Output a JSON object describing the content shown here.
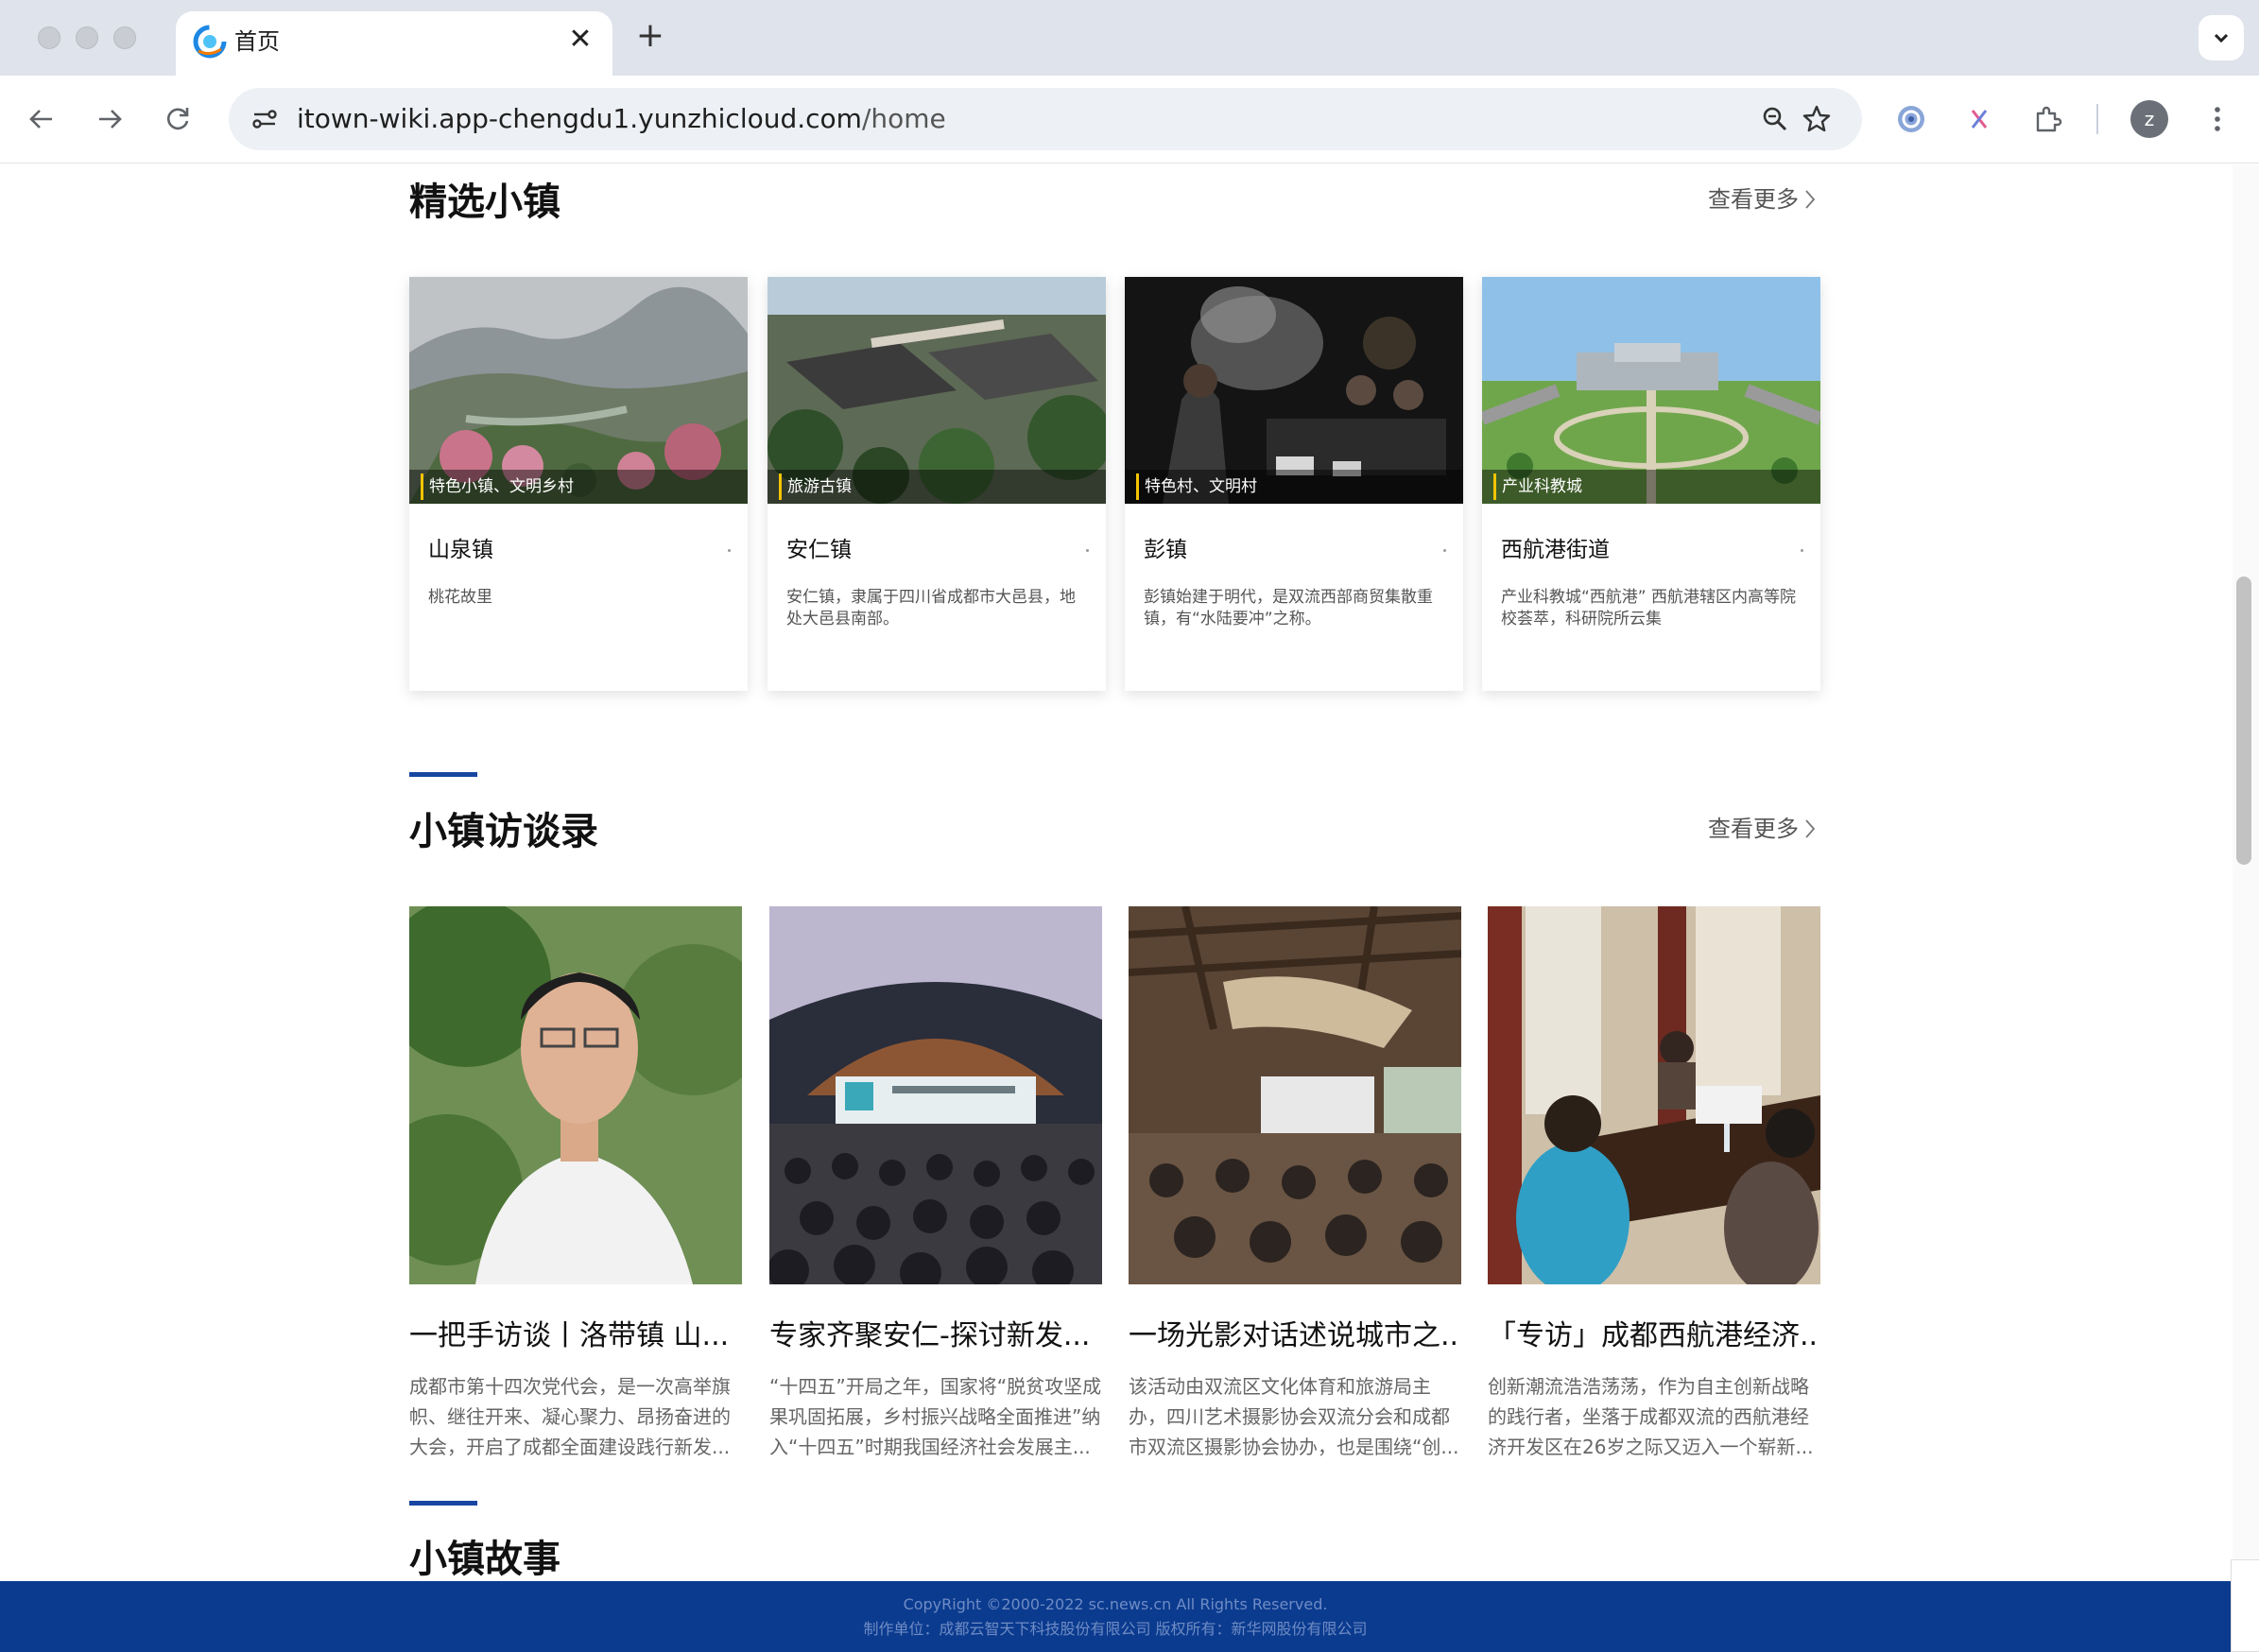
{
  "browser": {
    "tab_title": "首页",
    "url_host": "itown-wiki.app-chengdu1.yunzhicloud.com",
    "url_path": "/home",
    "profile_initial": "z",
    "icons": [
      "back-icon",
      "forward-icon",
      "reload-icon",
      "site-info-icon",
      "zoom-icon",
      "bookmark-star-icon",
      "extension-icon",
      "puzzle-icon",
      "menu-icon"
    ]
  },
  "featured": {
    "title": "精选小镇",
    "more": "查看更多",
    "cards": [
      {
        "tag": "特色小镇、文明乡村",
        "name": "山泉镇",
        "desc": "桃花故里"
      },
      {
        "tag": "旅游古镇",
        "name": "安仁镇",
        "desc": "安仁镇，隶属于四川省成都市大邑县，地处大邑县南部。"
      },
      {
        "tag": "特色村、文明村",
        "name": "彭镇",
        "desc": "彭镇始建于明代，是双流西部商贸集散重镇，有“水陆要冲”之称。"
      },
      {
        "tag": "产业科教城",
        "name": "西航港街道",
        "desc": "产业科教城“西航港” 西航港辖区内高等院校荟萃，科研院所云集"
      }
    ]
  },
  "interviews": {
    "title": "小镇访谈录",
    "more": "查看更多",
    "items": [
      {
        "title": "一把手访谈丨洛带镇 山...",
        "desc": "成都市第十四次党代会，是一次高举旗帜、继往开来、凝心聚力、昂扬奋进的大会，开启了成都全面建设践行新发..."
      },
      {
        "title": "专家齐聚安仁-探讨新发...",
        "desc": "“十四五”开局之年，国家将“脱贫攻坚成果巩固拓展，乡村振兴战略全面推进”纳入“十四五”时期我国经济社会发展主..."
      },
      {
        "title": "一场光影对话述说城市之...",
        "desc": "该活动由双流区文化体育和旅游局主办，四川艺术摄影协会双流分会和成都市双流区摄影协会协办，也是围绕“创..."
      },
      {
        "title": "「专访」成都西航港经济...",
        "desc": "创新潮流浩浩荡荡，作为自主创新战略的践行者，坐落于成都双流的西航港经济开发区在26岁之际又迈入一个崭新..."
      }
    ]
  },
  "stories": {
    "title": "小镇故事"
  },
  "footer": {
    "copyright": "CopyRight ©2000-2022 sc.news.cn All Rights Reserved.",
    "credits": "制作单位：成都云智天下科技股份有限公司 版权所有：新华网股份有限公司"
  },
  "colors": {
    "accent": "#1746a2",
    "footer_bg": "#0b3b8f",
    "tag_mark": "#f5c400"
  }
}
